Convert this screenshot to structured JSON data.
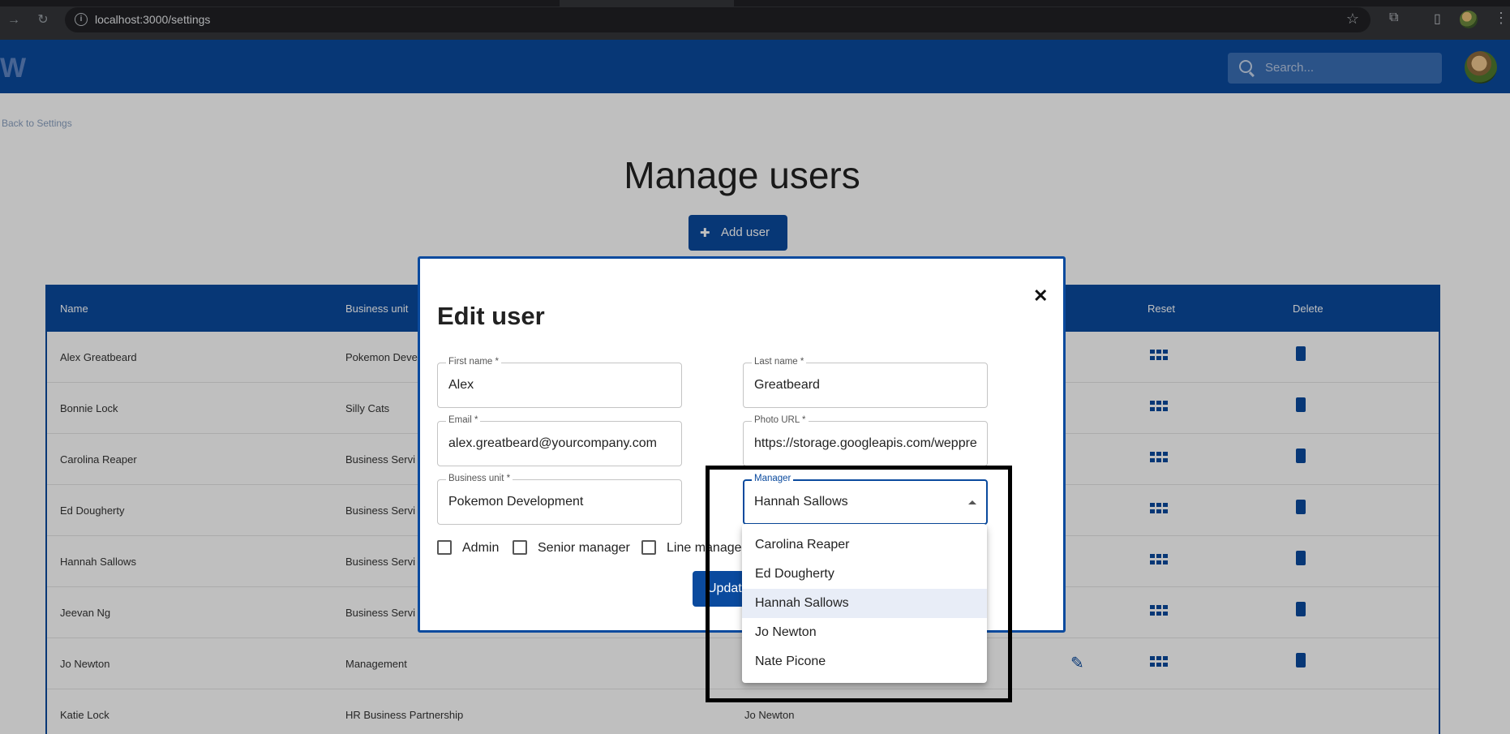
{
  "browser": {
    "url": "localhost:3000/settings"
  },
  "app": {
    "search_placeholder": "Search...",
    "back_link": "Back to Settings",
    "page_title": "Manage users",
    "add_user_label": "Add user",
    "table": {
      "headers": {
        "name": "Name",
        "business_unit": "Business unit",
        "reset": "Reset",
        "delete": "Delete"
      },
      "rows": [
        {
          "name": "Alex Greatbeard",
          "business_unit": "Pokemon Deve",
          "manager": ""
        },
        {
          "name": "Bonnie Lock",
          "business_unit": "Silly Cats",
          "manager": ""
        },
        {
          "name": "Carolina Reaper",
          "business_unit": "Business Servi",
          "manager": ""
        },
        {
          "name": "Ed Dougherty",
          "business_unit": "Business Servi",
          "manager": ""
        },
        {
          "name": "Hannah Sallows",
          "business_unit": "Business Servi",
          "manager": ""
        },
        {
          "name": "Jeevan Ng",
          "business_unit": "Business Servi",
          "manager": ""
        },
        {
          "name": "Jo Newton",
          "business_unit": "Management",
          "manager": ""
        },
        {
          "name": "Katie Lock",
          "business_unit": "HR Business Partnership",
          "manager": "Jo Newton"
        }
      ]
    }
  },
  "modal": {
    "title": "Edit user",
    "close_symbol": "✕",
    "fields": {
      "first_name": {
        "label": "First name *",
        "value": "Alex"
      },
      "last_name": {
        "label": "Last name *",
        "value": "Greatbeard"
      },
      "email": {
        "label": "Email *",
        "value": "alex.greatbeard@yourcompany.com"
      },
      "photo_url": {
        "label": "Photo URL *",
        "value": "https://storage.googleapis.com/weppre"
      },
      "business_unit": {
        "label": "Business unit *",
        "value": "Pokemon Development"
      },
      "manager": {
        "label": "Manager",
        "value": "Hannah Sallows"
      }
    },
    "checkboxes": {
      "admin": {
        "label": "Admin",
        "checked": false
      },
      "senior_manager": {
        "label": "Senior manager",
        "checked": false
      },
      "line_manager": {
        "label": "Line manager",
        "checked": false
      }
    },
    "update_label": "Update"
  },
  "manager_dropdown": {
    "options": [
      "Carolina Reaper",
      "Ed Dougherty",
      "Hannah Sallows",
      "Jo Newton",
      "Nate Picone"
    ],
    "selected": "Hannah Sallows"
  },
  "colors": {
    "brand_blue": "#0a4a9e",
    "selected_option_bg": "#e8edf7"
  }
}
